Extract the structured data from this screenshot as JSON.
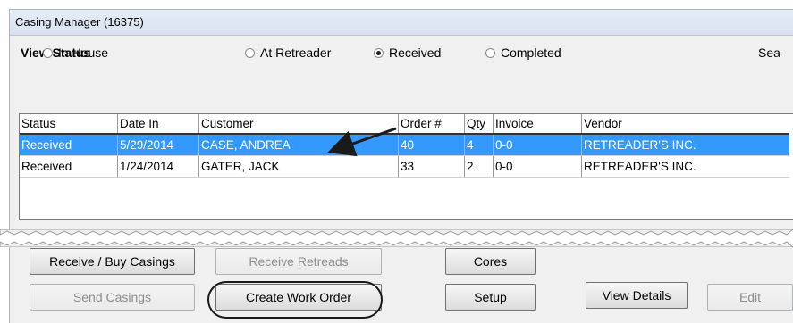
{
  "window": {
    "title": "Casing Manager (16375)"
  },
  "view_status": {
    "label": "View Status",
    "options": [
      {
        "label": "In House",
        "checked": false
      },
      {
        "label": "At Retreader",
        "checked": false
      },
      {
        "label": "Received",
        "checked": true
      },
      {
        "label": "Completed",
        "checked": false
      }
    ],
    "search_label": "Sea"
  },
  "grid": {
    "columns": [
      "Status",
      "Date In",
      "Customer",
      "Order #",
      "Qty",
      "Invoice",
      "Vendor"
    ],
    "rows": [
      {
        "status": "Received",
        "date_in": "5/29/2014",
        "customer": "CASE, ANDREA",
        "order": "40",
        "qty": "4",
        "invoice": "0-0",
        "vendor": "RETREADER'S INC.",
        "selected": true
      },
      {
        "status": "Received",
        "date_in": "1/24/2014",
        "customer": "GATER, JACK",
        "order": "33",
        "qty": "2",
        "invoice": "0-0",
        "vendor": "RETREADER'S INC.",
        "selected": false
      }
    ]
  },
  "buttons": {
    "receive_buy_casings": "Receive / Buy Casings",
    "receive_retreads": "Receive Retreads",
    "cores": "Cores",
    "send_casings": "Send Casings",
    "create_work_order": "Create Work Order",
    "setup": "Setup",
    "view_details": "View Details",
    "edit": "Edit"
  },
  "colors": {
    "selection": "#3399ff",
    "annotation": "#1a1a1a"
  }
}
